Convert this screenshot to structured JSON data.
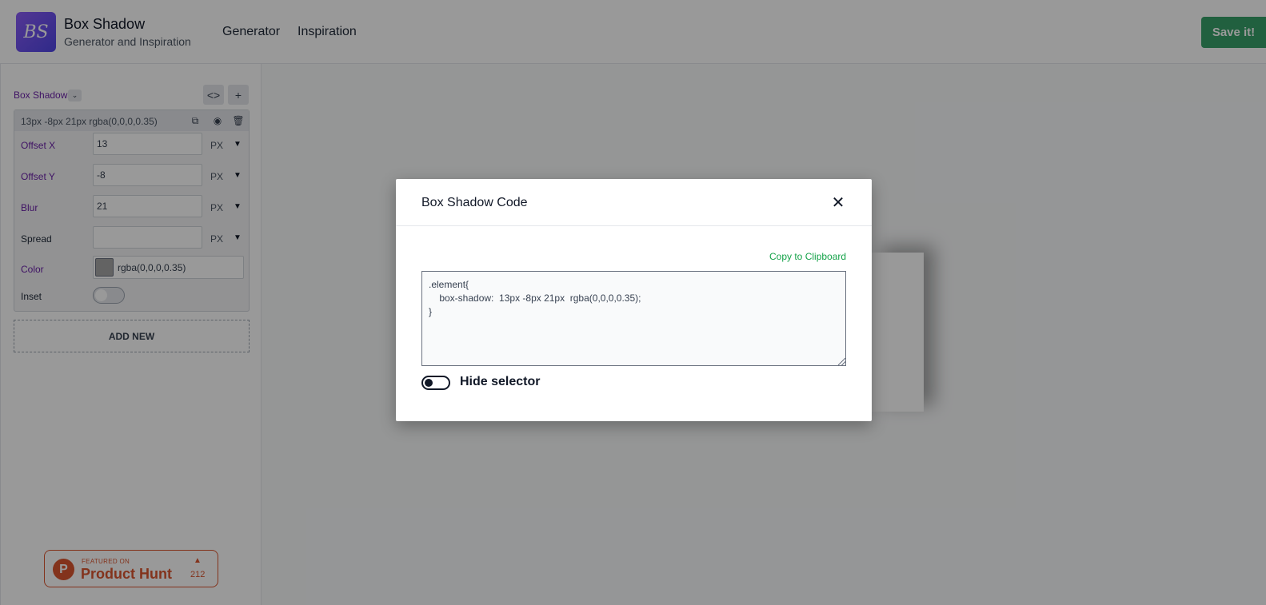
{
  "header": {
    "logo_text": "BS",
    "brand_title": "Box Shadow",
    "brand_subtitle": "Generator and Inspiration",
    "nav": [
      "Generator",
      "Inspiration"
    ],
    "save_label": "Save it!"
  },
  "sidebar": {
    "section_label": "Box Shadows",
    "layer": {
      "title": "13px -8px 21px rgba(0,0,0,0.35)",
      "rows": [
        {
          "label": "Offset X",
          "value": "13",
          "unit": "PX"
        },
        {
          "label": "Offset Y",
          "value": "-8",
          "unit": "PX"
        },
        {
          "label": "Blur",
          "value": "21",
          "unit": "PX"
        },
        {
          "label": "Spread",
          "value": "",
          "unit": "PX"
        }
      ],
      "color_label": "Color",
      "color_value": "rgba(0,0,0,0.35)",
      "inset_label": "Inset"
    },
    "add_new_label": "ADD NEW",
    "product_hunt": {
      "featured": "FEATURED ON",
      "name": "Product Hunt",
      "count": "212"
    }
  },
  "modal": {
    "title": "Box Shadow Code",
    "copy_label": "Copy to Clipboard",
    "code": ".element{\n    box-shadow:  13px -8px 21px  rgba(0,0,0,0.35);\n}",
    "hide_selector_label": "Hide selector"
  },
  "colors": {
    "accent_purple": "#6b21a8",
    "save_green": "#38a169",
    "copy_green": "#16a34a",
    "product_hunt": "#da552f"
  }
}
